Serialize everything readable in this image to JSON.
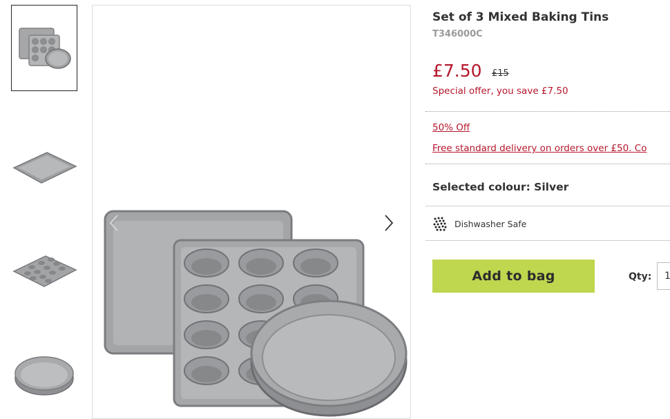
{
  "product": {
    "title": "Set of 3 Mixed Baking Tins",
    "sku": "T346000C",
    "price": "£7.50",
    "was_price": "£15",
    "saving_text": "Special offer, you save £7.50"
  },
  "promotions": [
    {
      "label": "50% Off"
    },
    {
      "label": "Free standard delivery on orders over £50. Co"
    }
  ],
  "selected_colour": "Selected colour: Silver",
  "features": [
    {
      "icon": "dishwasher-icon",
      "label": "Dishwasher Safe"
    }
  ],
  "actions": {
    "add_to_bag": "Add to bag",
    "qty_label": "Qty:",
    "qty_value": "1"
  },
  "gallery": {
    "thumbnails": [
      "baking-tin-set",
      "baking-tray",
      "muffin-tray",
      "round-cake-tin"
    ],
    "selected_index": 0
  },
  "colors": {
    "price_red": "#b5162b",
    "add_button": "#bfd64f",
    "tin_metal": "#a9aaac"
  }
}
